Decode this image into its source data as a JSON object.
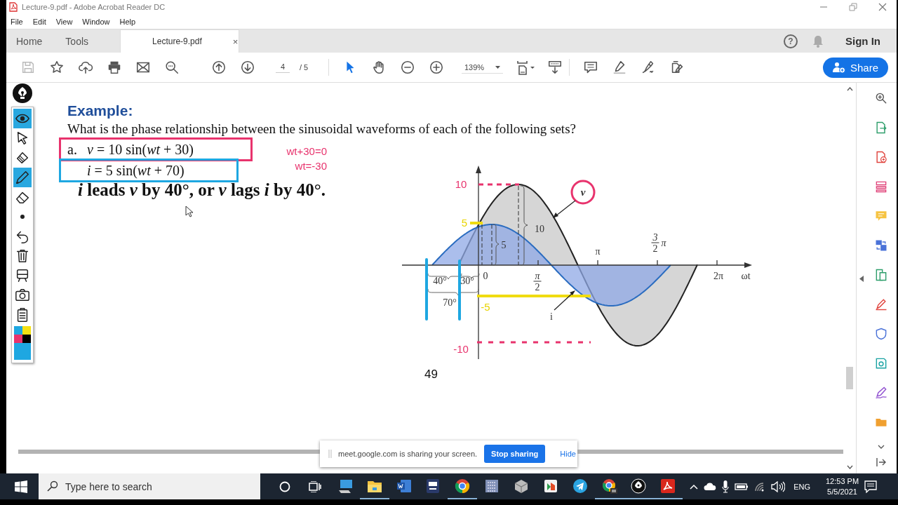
{
  "window": {
    "title": "Lecture-9.pdf - Adobe Acrobat Reader DC"
  },
  "menu": [
    "File",
    "Edit",
    "View",
    "Window",
    "Help"
  ],
  "nav_tabs": [
    {
      "label": "Home",
      "selected": false
    },
    {
      "label": "Tools",
      "selected": false
    },
    {
      "label": "Lecture-9.pdf",
      "selected": true,
      "close": "×"
    }
  ],
  "account": {
    "help": "?",
    "sign_in": "Sign In"
  },
  "toolbar": {
    "page": "4",
    "page_total": "/ 5",
    "zoom": "139%",
    "share": "Share",
    "tools": [
      {
        "kind": "select",
        "selected": true
      },
      {
        "kind": "hand",
        "selected": false
      }
    ]
  },
  "annotation_tools": [
    {
      "kind": "eye",
      "selected": true
    },
    {
      "kind": "cursor",
      "selected": false
    },
    {
      "kind": "highlighter",
      "selected": false
    },
    {
      "kind": "pen",
      "selected": true
    },
    {
      "kind": "eraser",
      "selected": false
    },
    {
      "kind": "dot",
      "selected": false
    },
    {
      "kind": "undo",
      "selected": false
    },
    {
      "kind": "trash",
      "selected": false
    },
    {
      "kind": "board",
      "selected": false
    },
    {
      "kind": "camera",
      "selected": false
    },
    {
      "kind": "clipboard",
      "selected": false
    },
    {
      "kind": "palette",
      "selected": false
    }
  ],
  "document": {
    "heading": "Example:",
    "question": "What is the phase relationship between the sinusoidal waveforms of each of the following sets?",
    "formulas": [
      {
        "label": "a.",
        "text": "*v* = 10 sin(*wt* + 30)",
        "color": "#e8336d"
      },
      {
        "text": "*i* = 5 sin(*wt* + 70)",
        "color": "#1ea7e1"
      }
    ],
    "notes": [
      "wt+30=0",
      "wt=-30"
    ],
    "statement": "*i* leads *v* by 40°, or *v* lags *i* by 40°.",
    "figure": {
      "labels": [
        {
          "text": "10",
          "color": "#e8336d"
        },
        {
          "text": "5",
          "color": "#e9d400"
        },
        {
          "text": "-5",
          "color": "#e9d400"
        },
        {
          "text": "-10",
          "color": "#e8336d"
        },
        {
          "text": "v",
          "kind": "circled"
        },
        {
          "text": "10"
        },
        {
          "text": "5"
        },
        {
          "text": "0"
        },
        {
          "kind": "fraction",
          "numerator": "π",
          "denominator": "2"
        },
        {
          "text": "π"
        },
        {
          "kind": "fraction",
          "numerator": "3",
          "denominator": "2",
          "suffix": "π"
        },
        {
          "text": "2π"
        },
        {
          "text": "ωt"
        },
        {
          "text": "40°"
        },
        {
          "text": "30°"
        },
        {
          "text": "70°"
        },
        {
          "text": "i"
        }
      ]
    },
    "page_number": "49"
  },
  "share_bar": {
    "message": "meet.google.com is sharing your screen.",
    "stop": "Stop sharing",
    "hide": "Hide"
  },
  "taskbar": {
    "search_placeholder": "Type here to search",
    "apps": [
      {
        "kind": "monitor",
        "running": false
      },
      {
        "kind": "folder",
        "running": true
      },
      {
        "kind": "word",
        "running": false
      },
      {
        "kind": "server",
        "running": false
      },
      {
        "kind": "wheel",
        "running": true
      },
      {
        "kind": "calculator",
        "running": false
      },
      {
        "kind": "box",
        "running": false
      },
      {
        "kind": "slides",
        "running": false
      },
      {
        "kind": "plane",
        "running": false
      },
      {
        "kind": "wheel2",
        "running": true
      },
      {
        "kind": "pen",
        "running": true
      },
      {
        "kind": "pdf",
        "running": true
      }
    ],
    "language": "ENG",
    "time": "12:53 PM",
    "date": "5/5/2021"
  }
}
